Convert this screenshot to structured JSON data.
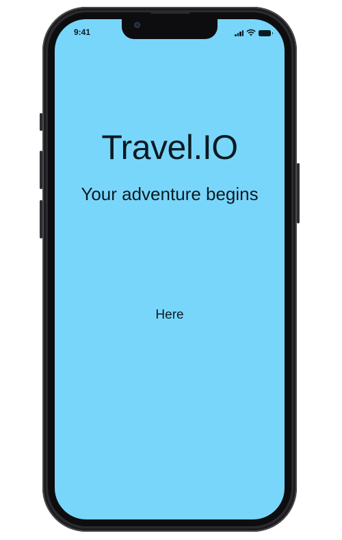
{
  "status_bar": {
    "time": "9:41"
  },
  "screen": {
    "background_color": "#79d6fb",
    "title": "Travel.IO",
    "subtitle": "Your adventure begins",
    "link_text": "Here"
  },
  "icons": {
    "signal": "cellular-signal-icon",
    "wifi": "wifi-icon",
    "battery": "battery-icon",
    "camera": "front-camera-icon"
  }
}
